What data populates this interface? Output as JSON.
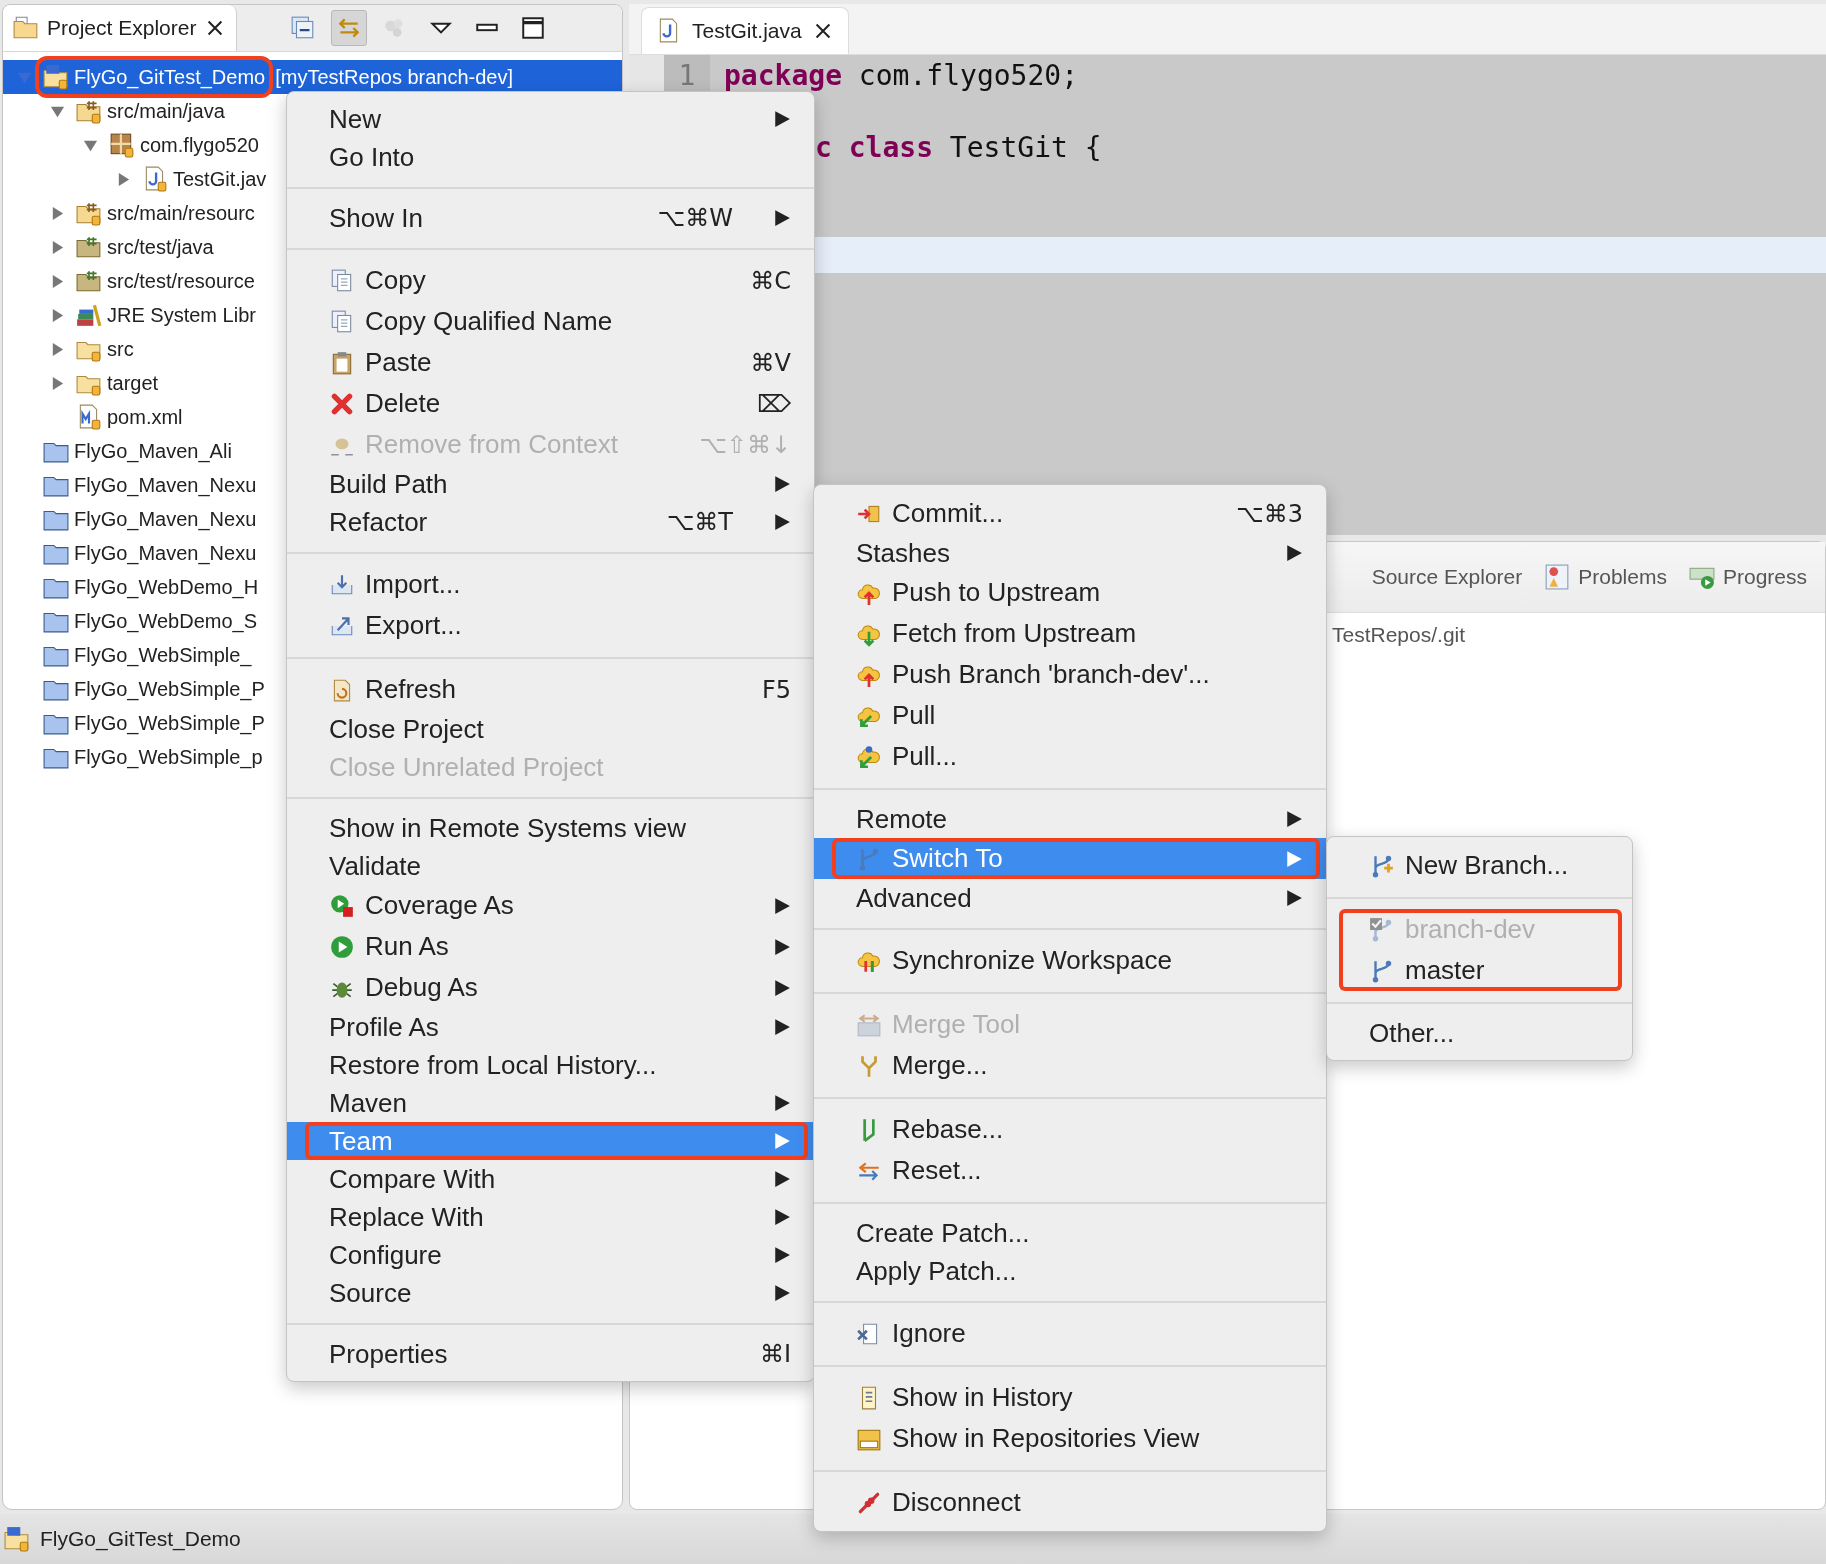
{
  "project_explorer": {
    "title": "Project Explorer",
    "toolbar": [
      {
        "selected": false,
        "disabled": false
      },
      {
        "selected": true,
        "disabled": false
      },
      {
        "selected": false,
        "disabled": true
      },
      {
        "selected": false,
        "disabled": false
      },
      {
        "selected": false,
        "disabled": false
      },
      {
        "selected": false,
        "disabled": false
      }
    ],
    "tree": [
      {
        "kind": "project",
        "label": "FlyGo_GitTest_Demo",
        "decoration": "[myTestRepos branch-dev]",
        "expanded": true,
        "selected": true,
        "annotated": true,
        "children": [
          {
            "kind": "source-folder",
            "label": "src/main/java",
            "expanded": true,
            "selected": false,
            "annotated": false,
            "children": [
              {
                "kind": "package",
                "label": "com.flygo520",
                "expanded": true,
                "selected": false,
                "annotated": false,
                "children": [
                  {
                    "kind": "java-file",
                    "label": "TestGit.jav",
                    "expanded": false,
                    "selected": false,
                    "annotated": false
                  }
                ]
              }
            ]
          },
          {
            "kind": "source-folder",
            "label": "src/main/resourc",
            "expanded": false,
            "selected": false,
            "annotated": false
          },
          {
            "kind": "test-folder",
            "label": "src/test/java",
            "expanded": false,
            "selected": false,
            "annotated": false
          },
          {
            "kind": "test-folder",
            "label": "src/test/resource",
            "expanded": false,
            "selected": false,
            "annotated": false
          },
          {
            "kind": "library",
            "label": "JRE System Libr",
            "expanded": false,
            "selected": false,
            "annotated": false
          },
          {
            "kind": "folder",
            "label": "src",
            "expanded": false,
            "selected": false,
            "annotated": false
          },
          {
            "kind": "folder",
            "label": "target",
            "expanded": false,
            "selected": false,
            "annotated": false
          },
          {
            "kind": "xml-file",
            "label": "pom.xml",
            "selected": false,
            "annotated": false
          }
        ]
      },
      {
        "kind": "closed-project",
        "label": "FlyGo_Maven_Ali",
        "selected": false,
        "annotated": false
      },
      {
        "kind": "closed-project",
        "label": "FlyGo_Maven_Nexu",
        "selected": false,
        "annotated": false
      },
      {
        "kind": "closed-project",
        "label": "FlyGo_Maven_Nexu",
        "selected": false,
        "annotated": false
      },
      {
        "kind": "closed-project",
        "label": "FlyGo_Maven_Nexu",
        "selected": false,
        "annotated": false
      },
      {
        "kind": "closed-project",
        "label": "FlyGo_WebDemo_H",
        "selected": false,
        "annotated": false
      },
      {
        "kind": "closed-project",
        "label": "FlyGo_WebDemo_S",
        "selected": false,
        "annotated": false
      },
      {
        "kind": "closed-project",
        "label": "FlyGo_WebSimple_",
        "selected": false,
        "annotated": false
      },
      {
        "kind": "closed-project",
        "label": "FlyGo_WebSimple_P",
        "selected": false,
        "annotated": false
      },
      {
        "kind": "closed-project",
        "label": "FlyGo_WebSimple_P",
        "selected": false,
        "annotated": false
      },
      {
        "kind": "closed-project",
        "label": "FlyGo_WebSimple_p",
        "selected": false,
        "annotated": false
      }
    ]
  },
  "editor": {
    "tab": "TestGit.java",
    "lines": [
      {
        "number": "1",
        "current": false,
        "tokens": [
          {
            "text": "package",
            "keyword": true
          },
          {
            "text": " com.flygo520;",
            "keyword": false
          }
        ]
      },
      {
        "current": false
      },
      {
        "current": false,
        "tokens": [
          {
            "text": "c class",
            "keyword": true
          },
          {
            "text": " TestGit {",
            "keyword": false
          }
        ]
      },
      {
        "current": false
      },
      {
        "current": false
      },
      {
        "current": true
      }
    ]
  },
  "bottom_panel": {
    "tabs": [
      "Source Explorer",
      "Problems",
      "Progress"
    ],
    "path": "TestRepos/.git"
  },
  "context_menu": {
    "items": [
      {
        "kind": "item",
        "label": "New",
        "submenu": true,
        "selected": false,
        "disabled": false,
        "annotated": false
      },
      {
        "kind": "item",
        "label": "Go Into",
        "submenu": false,
        "selected": false,
        "disabled": false,
        "annotated": false
      },
      {
        "kind": "separator"
      },
      {
        "kind": "item",
        "label": "Show In",
        "shortcut": "⌥⌘W",
        "submenu": true,
        "selected": false,
        "disabled": false,
        "annotated": false
      },
      {
        "kind": "separator"
      },
      {
        "kind": "item",
        "label": "Copy",
        "shortcut": "⌘C",
        "submenu": false,
        "selected": false,
        "disabled": false,
        "annotated": false
      },
      {
        "kind": "item",
        "label": "Copy Qualified Name",
        "submenu": false,
        "selected": false,
        "disabled": false,
        "annotated": false
      },
      {
        "kind": "item",
        "label": "Paste",
        "shortcut": "⌘V",
        "submenu": false,
        "selected": false,
        "disabled": false,
        "annotated": false
      },
      {
        "kind": "item",
        "label": "Delete",
        "shortcut": "⌦",
        "submenu": false,
        "selected": false,
        "disabled": false,
        "annotated": false
      },
      {
        "kind": "item",
        "label": "Remove from Context",
        "shortcut": "⌥⇧⌘↓",
        "submenu": false,
        "selected": false,
        "disabled": true,
        "annotated": false
      },
      {
        "kind": "item",
        "label": "Build Path",
        "submenu": true,
        "selected": false,
        "disabled": false,
        "annotated": false
      },
      {
        "kind": "item",
        "label": "Refactor",
        "shortcut": "⌥⌘T",
        "submenu": true,
        "selected": false,
        "disabled": false,
        "annotated": false
      },
      {
        "kind": "separator"
      },
      {
        "kind": "item",
        "label": "Import...",
        "submenu": false,
        "selected": false,
        "disabled": false,
        "annotated": false
      },
      {
        "kind": "item",
        "label": "Export...",
        "submenu": false,
        "selected": false,
        "disabled": false,
        "annotated": false
      },
      {
        "kind": "separator"
      },
      {
        "kind": "item",
        "label": "Refresh",
        "shortcut": "F5",
        "submenu": false,
        "selected": false,
        "disabled": false,
        "annotated": false
      },
      {
        "kind": "item",
        "label": "Close Project",
        "submenu": false,
        "selected": false,
        "disabled": false,
        "annotated": false
      },
      {
        "kind": "item",
        "label": "Close Unrelated Project",
        "submenu": false,
        "selected": false,
        "disabled": true,
        "annotated": false
      },
      {
        "kind": "separator"
      },
      {
        "kind": "item",
        "label": "Show in Remote Systems view",
        "submenu": false,
        "selected": false,
        "disabled": false,
        "annotated": false
      },
      {
        "kind": "item",
        "label": "Validate",
        "submenu": false,
        "selected": false,
        "disabled": false,
        "annotated": false
      },
      {
        "kind": "item",
        "label": "Coverage As",
        "submenu": true,
        "selected": false,
        "disabled": false,
        "annotated": false
      },
      {
        "kind": "item",
        "label": "Run As",
        "submenu": true,
        "selected": false,
        "disabled": false,
        "annotated": false
      },
      {
        "kind": "item",
        "label": "Debug As",
        "submenu": true,
        "selected": false,
        "disabled": false,
        "annotated": false
      },
      {
        "kind": "item",
        "label": "Profile As",
        "submenu": true,
        "selected": false,
        "disabled": false,
        "annotated": false
      },
      {
        "kind": "item",
        "label": "Restore from Local History...",
        "submenu": false,
        "selected": false,
        "disabled": false,
        "annotated": false
      },
      {
        "kind": "item",
        "label": "Maven",
        "submenu": true,
        "selected": false,
        "disabled": false,
        "annotated": false
      },
      {
        "kind": "item",
        "label": "Team",
        "submenu": true,
        "selected": true,
        "disabled": false,
        "annotated": true
      },
      {
        "kind": "item",
        "label": "Compare With",
        "submenu": true,
        "selected": false,
        "disabled": false,
        "annotated": false
      },
      {
        "kind": "item",
        "label": "Replace With",
        "submenu": true,
        "selected": false,
        "disabled": false,
        "annotated": false
      },
      {
        "kind": "item",
        "label": "Configure",
        "submenu": true,
        "selected": false,
        "disabled": false,
        "annotated": false
      },
      {
        "kind": "item",
        "label": "Source",
        "submenu": true,
        "selected": false,
        "disabled": false,
        "annotated": false
      },
      {
        "kind": "separator"
      },
      {
        "kind": "item",
        "label": "Properties",
        "shortcut": "⌘I",
        "submenu": false,
        "selected": false,
        "disabled": false,
        "annotated": false
      }
    ]
  },
  "team_submenu": {
    "items": [
      {
        "kind": "item",
        "label": "Commit...",
        "shortcut": "⌥⌘3",
        "submenu": false,
        "selected": false,
        "disabled": false,
        "annotated": false
      },
      {
        "kind": "item",
        "label": "Stashes",
        "submenu": true,
        "selected": false,
        "disabled": false,
        "annotated": false
      },
      {
        "kind": "item",
        "label": "Push to Upstream",
        "submenu": false,
        "selected": false,
        "disabled": false,
        "annotated": false
      },
      {
        "kind": "item",
        "label": "Fetch from Upstream",
        "submenu": false,
        "selected": false,
        "disabled": false,
        "annotated": false
      },
      {
        "kind": "item",
        "label": "Push Branch 'branch-dev'...",
        "submenu": false,
        "selected": false,
        "disabled": false,
        "annotated": false
      },
      {
        "kind": "item",
        "label": "Pull",
        "submenu": false,
        "selected": false,
        "disabled": false,
        "annotated": false
      },
      {
        "kind": "item",
        "label": "Pull...",
        "submenu": false,
        "selected": false,
        "disabled": false,
        "annotated": false
      },
      {
        "kind": "separator"
      },
      {
        "kind": "item",
        "label": "Remote",
        "submenu": true,
        "selected": false,
        "disabled": false,
        "annotated": false
      },
      {
        "kind": "item",
        "label": "Switch To",
        "submenu": true,
        "selected": true,
        "disabled": false,
        "annotated": true
      },
      {
        "kind": "item",
        "label": "Advanced",
        "submenu": true,
        "selected": false,
        "disabled": false,
        "annotated": false
      },
      {
        "kind": "separator"
      },
      {
        "kind": "item",
        "label": "Synchronize Workspace",
        "submenu": false,
        "selected": false,
        "disabled": false,
        "annotated": false
      },
      {
        "kind": "separator"
      },
      {
        "kind": "item",
        "label": "Merge Tool",
        "submenu": false,
        "selected": false,
        "disabled": true,
        "annotated": false
      },
      {
        "kind": "item",
        "label": "Merge...",
        "submenu": false,
        "selected": false,
        "disabled": false,
        "annotated": false
      },
      {
        "kind": "separator"
      },
      {
        "kind": "item",
        "label": "Rebase...",
        "submenu": false,
        "selected": false,
        "disabled": false,
        "annotated": false
      },
      {
        "kind": "item",
        "label": "Reset...",
        "submenu": false,
        "selected": false,
        "disabled": false,
        "annotated": false
      },
      {
        "kind": "separator"
      },
      {
        "kind": "item",
        "label": "Create Patch...",
        "submenu": false,
        "selected": false,
        "disabled": false,
        "annotated": false
      },
      {
        "kind": "item",
        "label": "Apply Patch...",
        "submenu": false,
        "selected": false,
        "disabled": false,
        "annotated": false
      },
      {
        "kind": "separator"
      },
      {
        "kind": "item",
        "label": "Ignore",
        "submenu": false,
        "selected": false,
        "disabled": false,
        "annotated": false
      },
      {
        "kind": "separator"
      },
      {
        "kind": "item",
        "label": "Show in History",
        "submenu": false,
        "selected": false,
        "disabled": false,
        "annotated": false
      },
      {
        "kind": "item",
        "label": "Show in Repositories View",
        "submenu": false,
        "selected": false,
        "disabled": false,
        "annotated": false
      },
      {
        "kind": "separator"
      },
      {
        "kind": "item",
        "label": "Disconnect",
        "submenu": false,
        "selected": false,
        "disabled": false,
        "annotated": false
      }
    ]
  },
  "switch_to_submenu": {
    "items": [
      {
        "kind": "item",
        "label": "New Branch...",
        "submenu": false,
        "selected": false,
        "disabled": false,
        "annotated": false
      },
      {
        "kind": "separator"
      },
      {
        "kind": "item",
        "label": "branch-dev",
        "submenu": false,
        "selected": false,
        "disabled": true,
        "annotated": true
      },
      {
        "kind": "item",
        "label": "master",
        "submenu": false,
        "selected": false,
        "disabled": false,
        "annotated": true
      },
      {
        "kind": "separator"
      },
      {
        "kind": "item",
        "label": "Other...",
        "submenu": false,
        "selected": false,
        "disabled": false,
        "annotated": false
      }
    ]
  },
  "status_bar": {
    "text": "FlyGo_GitTest_Demo"
  }
}
